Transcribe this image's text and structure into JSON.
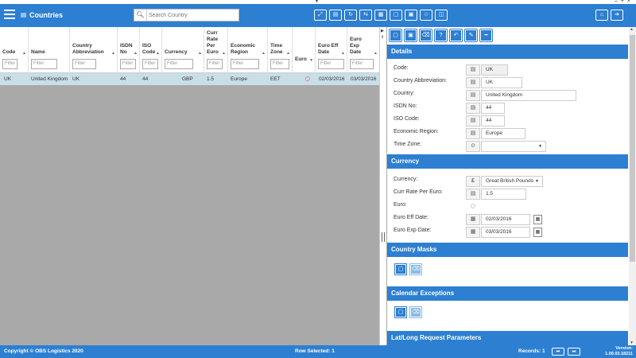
{
  "header": {
    "title": "Countries",
    "search_placeholder": "Search Country",
    "toolbar_icons": [
      "expand-icon",
      "database-icon",
      "refresh-icon",
      "share-icon",
      "grid-view-icon",
      "document-icon",
      "report-icon",
      "star-icon",
      "columns-icon"
    ],
    "right_icons": [
      "home-icon",
      "logout-icon"
    ]
  },
  "window": {
    "controls": "– + ×"
  },
  "grid": {
    "filter_placeholder": "Filter",
    "columns": [
      {
        "label": "Code"
      },
      {
        "label": "Name"
      },
      {
        "label": "Country Abbreviation"
      },
      {
        "label": "ISDN No"
      },
      {
        "label": "ISO Code"
      },
      {
        "label": "Currency"
      },
      {
        "label": "Curr Rate Per Euro"
      },
      {
        "label": "Economic Region"
      },
      {
        "label": "Time Zone"
      },
      {
        "label": "Euro"
      },
      {
        "label": "Euro Eff Date"
      },
      {
        "label": "Euro Exp Date"
      }
    ],
    "rows": [
      {
        "code": "UK",
        "name": "United Kingdom",
        "abbr": "UK",
        "isdn": "44",
        "iso": "44",
        "currency": "GBP",
        "rate": "1.5",
        "region": "Europe",
        "tz": "EET",
        "euro": "",
        "eff": "02/03/2016",
        "exp": "03/03/2016"
      }
    ]
  },
  "panel": {
    "toolbar_icons": [
      "new-icon",
      "save-icon",
      "delete-icon",
      "help-icon",
      "undo-icon",
      "eraser-icon",
      "minimize-icon"
    ],
    "details": {
      "title": "Details",
      "code_label": "Code:",
      "code": "UK",
      "abbr_label": "Country Abbreviation:",
      "abbr": "UK",
      "country_label": "Country:",
      "country": "United Kingdom",
      "isdn_label": "ISDN No:",
      "isdn": "44",
      "iso_label": "ISO Code:",
      "iso": "44",
      "region_label": "Economic Region:",
      "region": "Europe",
      "tz_label": "Time Zone:",
      "tz": ""
    },
    "currency": {
      "title": "Currency",
      "currency_label": "Currency:",
      "currency_symbol": "£",
      "currency": "Great British Pounds",
      "rate_label": "Curr Rate Per Euro:",
      "rate": "1.5",
      "euro_label": "Euro:",
      "eff_label": "Euro Eff Date:",
      "eff": "02/03/2016",
      "exp_label": "Euro Exp Date:",
      "exp": "03/03/2016"
    },
    "masks": {
      "title": "Country Masks"
    },
    "calendar": {
      "title": "Calendar Exceptions"
    },
    "latlong": {
      "title": "Lat/Long Request Parameters"
    }
  },
  "footer": {
    "copyright": "Copyright © OBS Logistics 2020",
    "row_selected": "Row Selected: 1",
    "records": "Records: 1",
    "version_label": "Version:",
    "version": "1.00.03.18211"
  },
  "colors": {
    "accent": "#2d7fd2",
    "selected_row": "#c8dfe8",
    "grid_bg": "#a9a9a9"
  }
}
